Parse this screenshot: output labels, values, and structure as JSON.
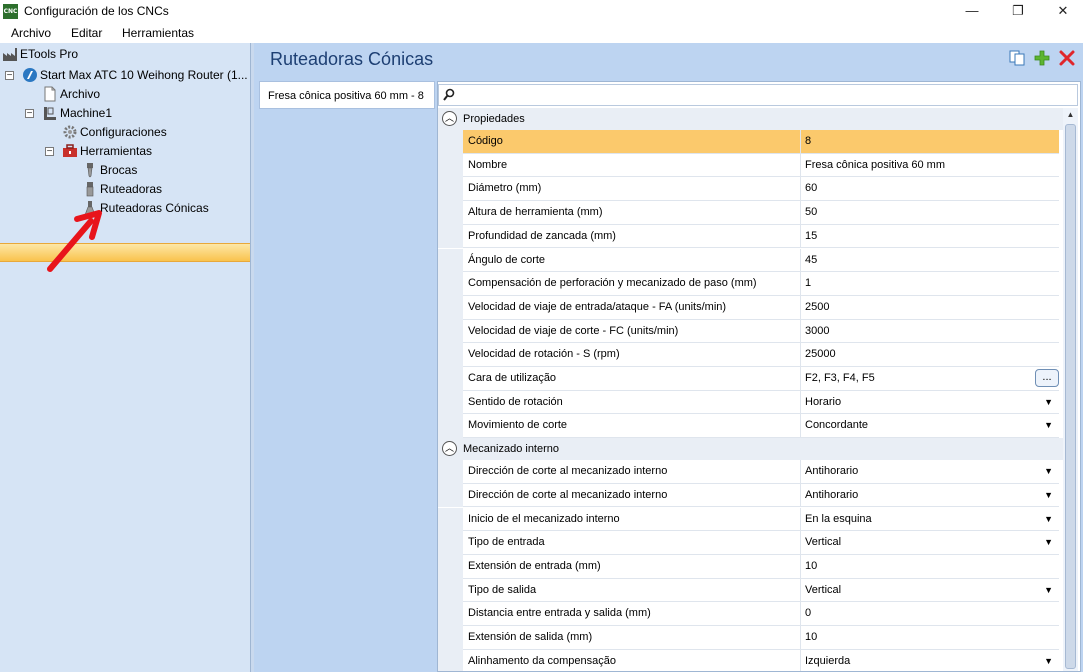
{
  "window": {
    "title": "Configuración de los CNCs",
    "app_icon_text": "CNC",
    "controls": [
      "—",
      "❐",
      "✕"
    ]
  },
  "menu": [
    "Archivo",
    "Editar",
    "Herramientas"
  ],
  "tree": {
    "root": "ETools Pro",
    "machine_entry": "Start Max ATC 10 Weihong Router (1...",
    "archivo": "Archivo",
    "machine": "Machine1",
    "configuraciones": "Configuraciones",
    "herramientas": "Herramientas",
    "brocas": "Brocas",
    "ruteadoras": "Ruteadoras",
    "ruteadoras_conicas": "Ruteadoras Cónicas"
  },
  "header": {
    "title": "Ruteadoras Cónicas",
    "icons": [
      "copy-icon",
      "add-icon",
      "delete-icon"
    ]
  },
  "tools_list": [
    "Fresa cônica positiva 60 mm - 8"
  ],
  "search": {
    "placeholder": ""
  },
  "sections": [
    {
      "label": "Propiedades",
      "rows": [
        {
          "name": "Código",
          "value": "8",
          "control": "text"
        },
        {
          "name": "Nombre",
          "value": "Fresa cônica positiva 60 mm",
          "control": "text"
        },
        {
          "name": "Diámetro (mm)",
          "value": "60",
          "control": "text"
        },
        {
          "name": "Altura de herramienta (mm)",
          "value": "50",
          "control": "text"
        },
        {
          "name": "Profundidad de zancada (mm)",
          "value": "15",
          "control": "text"
        },
        {
          "name": "Ángulo de corte",
          "value": "45",
          "control": "text"
        },
        {
          "name": "Compensación de perforación y mecanizado de paso (mm)",
          "value": "1",
          "control": "text"
        },
        {
          "name": "Velocidad de viaje de entrada/ataque - FA (units/min)",
          "value": "2500",
          "control": "text"
        },
        {
          "name": "Velocidad de viaje de corte - FC (units/min)",
          "value": "3000",
          "control": "text"
        },
        {
          "name": "Velocidad de rotación - S (rpm)",
          "value": "25000",
          "control": "text"
        },
        {
          "name": "Cara de utilização",
          "value": "F2, F3, F4, F5",
          "control": "ellipsis"
        },
        {
          "name": "Sentido de rotación",
          "value": "Horario",
          "control": "dropdown"
        },
        {
          "name": "Movimiento de corte",
          "value": "Concordante",
          "control": "dropdown"
        }
      ]
    },
    {
      "label": "Mecanizado interno",
      "rows": [
        {
          "name": "Dirección de corte al mecanizado interno",
          "value": "Antihorario",
          "control": "dropdown"
        },
        {
          "name": "Dirección de corte al mecanizado interno",
          "value": "Antihorario",
          "control": "dropdown"
        },
        {
          "name": "Inicio de el mecanizado interno",
          "value": "En la esquina",
          "control": "dropdown"
        },
        {
          "name": "Tipo de entrada",
          "value": "Vertical",
          "control": "dropdown"
        },
        {
          "name": "Extensión de entrada (mm)",
          "value": "10",
          "control": "text"
        },
        {
          "name": "Tipo de salida",
          "value": "Vertical",
          "control": "dropdown"
        },
        {
          "name": "Distancia entre entrada y salida (mm)",
          "value": "0",
          "control": "text"
        },
        {
          "name": "Extensión de salida (mm)",
          "value": "10",
          "control": "text"
        },
        {
          "name": "Alinhamento da compensação",
          "value": "Izquierda",
          "control": "dropdown"
        }
      ]
    }
  ],
  "ellipsis_label": "...",
  "colors": {
    "selection": "#f9c34d",
    "row_highlight": "#fbc96c",
    "panel_bg": "#bdd4f1",
    "tree_bg": "#d6e4f5",
    "header_text": "#1d3f73",
    "annotation_arrow": "#e8141b"
  }
}
